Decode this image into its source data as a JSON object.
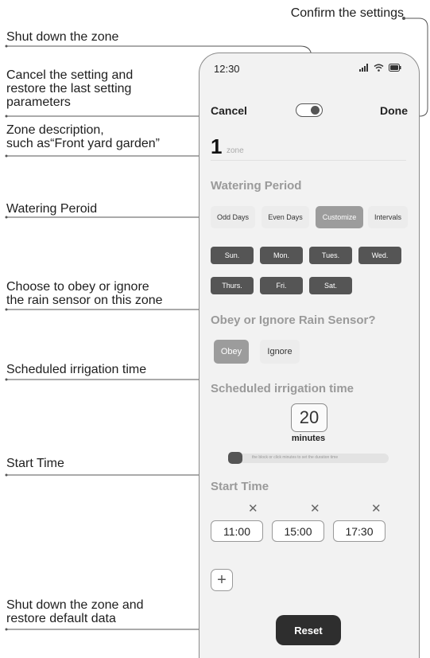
{
  "callouts": {
    "confirm": "Confirm the settings",
    "shutdown": "Shut down the zone",
    "cancel": [
      "Cancel the setting and",
      "restore the last setting",
      "parameters"
    ],
    "zone_desc": [
      "Zone description,",
      "such as“Front yard garden”"
    ],
    "watering": "Watering Peroid",
    "rain": [
      "Choose to obey or ignore",
      "the rain sensor on this zone"
    ],
    "scheduled": "Scheduled irrigation time",
    "start": "Start Time",
    "reset": [
      "Shut down the zone and",
      "restore default data"
    ]
  },
  "phone": {
    "status_time": "12:30",
    "status_icons": [
      "signal-icon",
      "wifi-icon",
      "battery-icon"
    ],
    "nav": {
      "cancel": "Cancel",
      "done": "Done",
      "zone_on": true
    },
    "zone": {
      "number": "1",
      "placeholder": "zone"
    },
    "watering": {
      "title": "Watering Period",
      "options": [
        "Odd Days",
        "Even Days",
        "Customize",
        "Intervals"
      ],
      "selected": "Customize",
      "days": [
        "Sun.",
        "Mon.",
        "Tues.",
        "Wed.",
        "Thurs.",
        "Fri.",
        "Sat."
      ]
    },
    "rain": {
      "title": "Obey or Ignore Rain Sensor?",
      "options": [
        "Obey",
        "Ignore"
      ],
      "selected": "Obey"
    },
    "scheduled": {
      "title": "Scheduled irrigation time",
      "value": "20",
      "unit": "minutes",
      "hint": "the block or click minutes to set the duration time",
      "slider_fraction": 0.0
    },
    "start": {
      "title": "Start Time",
      "times": [
        "11:00",
        "15:00",
        "17:30"
      ],
      "add_label": "+"
    },
    "reset": "Reset"
  },
  "colors": {
    "accent_dark": "#555555",
    "selected_chip": "#9c9c9c",
    "section_text": "#9a9a9a"
  }
}
